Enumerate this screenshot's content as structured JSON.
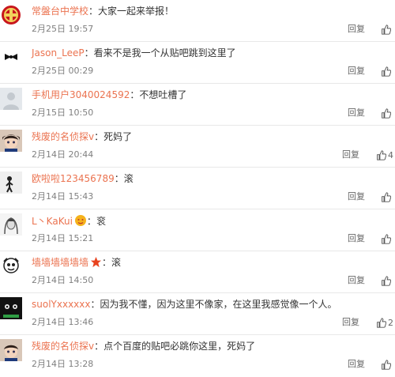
{
  "reply_label": "回复",
  "colors": {
    "username": "#eb7350",
    "timestamp": "#808080",
    "text": "#333333",
    "divider": "#e8e8e8"
  },
  "comments": [
    {
      "user": "常盤台中学校",
      "sep": "：",
      "text": "大家一起来举报！",
      "time": "2月25日 19:57",
      "like_count": "",
      "avatar": "red-emblem-avatar"
    },
    {
      "user": "Jason_LeeP",
      "sep": "：",
      "text": "看来不是我一个从贴吧跳到这里了",
      "time": "2月25日 00:29",
      "like_count": "",
      "avatar": "bowtie-avatar"
    },
    {
      "user": "手机用户3040024592",
      "sep": "：",
      "text": "不想吐槽了",
      "time": "2月15日 10:50",
      "like_count": "",
      "avatar": "default-avatar"
    },
    {
      "user": "残废的名侦探v",
      "sep": "：",
      "text": "死妈了",
      "time": "2月14日 20:44",
      "like_count": "4",
      "avatar": "anime-detective-avatar"
    },
    {
      "user": "欧啦啦123456789",
      "sep": "：",
      "text": "滚",
      "time": "2月14日 15:43",
      "like_count": "",
      "avatar": "figure-avatar"
    },
    {
      "user": "L丶KaKui",
      "sep": "：",
      "text": "衮",
      "time": "2月14日 15:21",
      "like_count": "",
      "avatar": "sketch-avatar"
    },
    {
      "user": "墙墙墙墙墙墙",
      "sep": "：",
      "text": "滚",
      "time": "2月14日 14:50",
      "like_count": "",
      "avatar": "cartoon-avatar"
    },
    {
      "user": "suolYxxxxxx",
      "sep": "：",
      "text": "因为我不懂，因为这里不像家，在这里我感觉像一个人。",
      "time": "2月14日 13:46",
      "like_count": "2",
      "avatar": "dark-avatar"
    },
    {
      "user": "残废的名侦探v",
      "sep": "：",
      "text": "点个百度的贴吧必跳你这里，死妈了",
      "time": "2月14日 13:28",
      "like_count": "",
      "avatar": "anime-detective-avatar"
    }
  ]
}
